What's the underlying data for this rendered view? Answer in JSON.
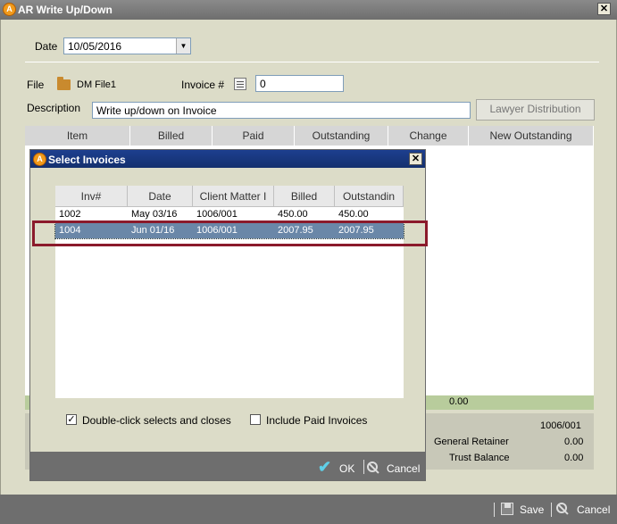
{
  "window": {
    "title": "AR Write Up/Down"
  },
  "date": {
    "label": "Date",
    "value": "10/05/2016"
  },
  "file": {
    "label": "File",
    "value": "DM File1"
  },
  "invoice": {
    "label": "Invoice #",
    "value": "0"
  },
  "description": {
    "label": "Description",
    "value": "Write up/down on Invoice"
  },
  "lawyer_button": "Lawyer Distribution",
  "grid": {
    "headers": [
      "Item",
      "Billed",
      "Paid",
      "Outstanding",
      "Change",
      "New Outstanding"
    ]
  },
  "totals_value": "0.00",
  "summary": {
    "client_matter": "1006/001",
    "general_retainer_label": "General Retainer",
    "general_retainer_value": "0.00",
    "trust_balance_label": "Trust Balance",
    "trust_balance_value": "0.00"
  },
  "footer": {
    "save": "Save",
    "cancel": "Cancel"
  },
  "dialog": {
    "title": "Select Invoices",
    "headers": [
      "Inv#",
      "Date",
      "Client Matter I",
      "Billed",
      "Outstandin"
    ],
    "rows": [
      {
        "inv": "1002",
        "date": "May 03/16",
        "matter": "1006/001",
        "billed": "450.00",
        "outstanding": "450.00"
      },
      {
        "inv": "1004",
        "date": "Jun 01/16",
        "matter": "1006/001",
        "billed": "2007.95",
        "outstanding": "2007.95"
      }
    ],
    "double_click_label": "Double-click selects and closes",
    "include_paid_label": "Include Paid Invoices",
    "ok": "OK",
    "cancel": "Cancel"
  },
  "colors": {
    "dialog_title": "#1d3f8f",
    "selection": "#6a87a8",
    "highlight_border": "#8b1a2b",
    "totals_band": "#b8cc9c"
  }
}
